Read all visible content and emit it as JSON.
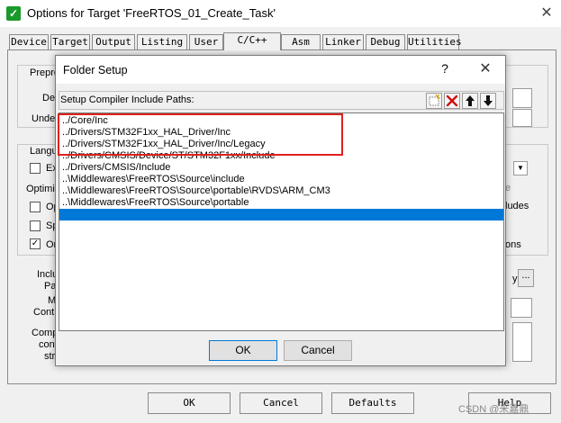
{
  "outer_window": {
    "title": "Options for Target 'FreeRTOS_01_Create_Task'",
    "icon": "keil-check-icon",
    "close_symbol": "✕"
  },
  "tabs": [
    {
      "label": "Device"
    },
    {
      "label": "Target"
    },
    {
      "label": "Output"
    },
    {
      "label": "Listing"
    },
    {
      "label": "User"
    },
    {
      "label": "C/C++",
      "active": true
    },
    {
      "label": "Asm"
    },
    {
      "label": "Linker"
    },
    {
      "label": "Debug"
    },
    {
      "label": "Utilities"
    }
  ],
  "behind": {
    "preproc_label": "Prepro",
    "define_label": "Def",
    "undefine_label": "Unde",
    "language_label": "Langu",
    "execute_label": "Ex",
    "optimize_label": "Optimi",
    "opt_one_label": "Op",
    "split_label": "Sp",
    "one_label": "On",
    "e_label": "e",
    "ludes_label": "ludes",
    "ons_label": "ons",
    "include_label": "Inclu",
    "paths_label": "Pat",
    "misc_label": "M",
    "controls_label": "Contr",
    "compiler_label": "Comp",
    "control_label": "cont",
    "string_label": "str",
    "browse_label": "...",
    "y_label": "y"
  },
  "bottom_buttons": {
    "ok": "OK",
    "cancel": "Cancel",
    "defaults": "Defaults",
    "help": "Help"
  },
  "folder_setup": {
    "title": "Folder Setup",
    "help_symbol": "?",
    "close_symbol": "✕",
    "label": "Setup Compiler Include Paths:",
    "toolbar": [
      {
        "name": "new-folder-icon"
      },
      {
        "name": "delete-icon"
      },
      {
        "name": "move-up-icon"
      },
      {
        "name": "move-down-icon"
      }
    ],
    "paths": [
      "../Core/Inc",
      "../Drivers/STM32F1xx_HAL_Driver/Inc",
      "../Drivers/STM32F1xx_HAL_Driver/Inc/Legacy",
      "../Drivers/CMSIS/Device/ST/STM32F1xx/Include",
      "../Drivers/CMSIS/Include",
      "..\\Middlewares\\FreeRTOS\\Source\\include",
      "..\\Middlewares\\FreeRTOS\\Source\\portable\\RVDS\\ARM_CM3",
      "..\\Middlewares\\FreeRTOS\\Source\\portable",
      ""
    ],
    "selected_index": 8,
    "ok": "OK",
    "cancel": "Cancel"
  },
  "watermark": "CSDN @米嘉鼎",
  "colors": {
    "selection": "#0078d7",
    "highlight_box": "#e02020",
    "icon_green": "#1a9a2a"
  }
}
